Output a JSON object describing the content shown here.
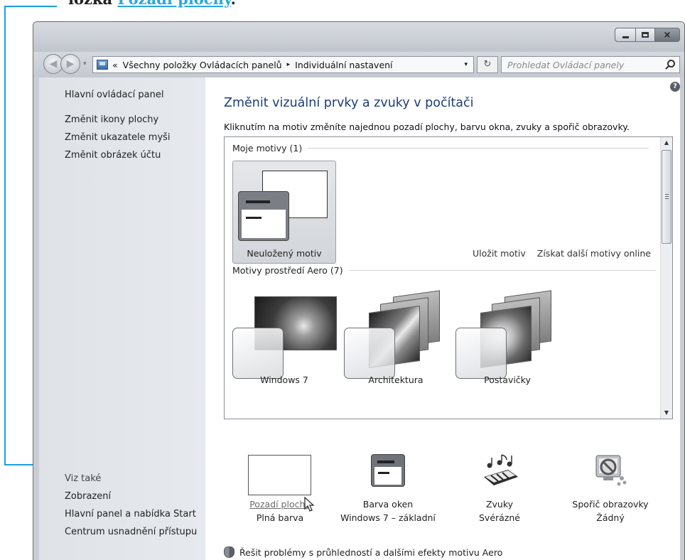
{
  "book": {
    "prefix": "ložka ",
    "link": "Pozadí plochy",
    "suffix": "."
  },
  "window": {
    "caption_buttons": {
      "minimize": "minimize-icon",
      "maximize": "maximize-icon",
      "close": "×"
    }
  },
  "nav": {
    "breadcrumb": [
      "«",
      "Všechny položky Ovládacích panelů",
      "▸",
      "Individuální nastavení"
    ],
    "dropdown": "▾",
    "refresh": "↻",
    "search_placeholder": "Prohledat Ovládací panely"
  },
  "sidebar": {
    "top_items": [
      "Hlavní ovládací panel",
      "Změnit ikony plochy",
      "Změnit ukazatele myši",
      "Změnit obrázek účtu"
    ],
    "see_also_heading": "Viz také",
    "see_also_items": [
      "Zobrazení",
      "Hlavní panel a nabídka Start",
      "Centrum usnadnění přístupu"
    ]
  },
  "main": {
    "help": "?",
    "title": "Změnit vizuální prvky a zvuky v počítači",
    "subtitle": "Kliknutím na motiv změníte najednou pozadí plochy, barvu okna, zvuky a spořič obrazovky.",
    "my_themes_group": "Moje motivy (1)",
    "unsaved_theme": "Neuložený motiv",
    "save_theme": "Uložit motiv",
    "get_more_online": "Získat další motivy online",
    "aero_group": "Motivy prostředí Aero (7)",
    "aero_themes": [
      "Windows 7",
      "Architektura",
      "Postavičky"
    ],
    "settings": [
      {
        "label": "Pozadí plochy",
        "value": "Plná barva"
      },
      {
        "label": "Barva oken",
        "value": "Windows 7 – základní"
      },
      {
        "label": "Zvuky",
        "value": "Svérázné"
      },
      {
        "label": "Spořič obrazovky",
        "value": "Žádný"
      }
    ],
    "troubleshoot": "Řešit problémy s průhledností a dalšími efekty motivu Aero"
  },
  "colors": {
    "callout": "#1aa0dd",
    "title_blue": "#1d3d7a"
  }
}
